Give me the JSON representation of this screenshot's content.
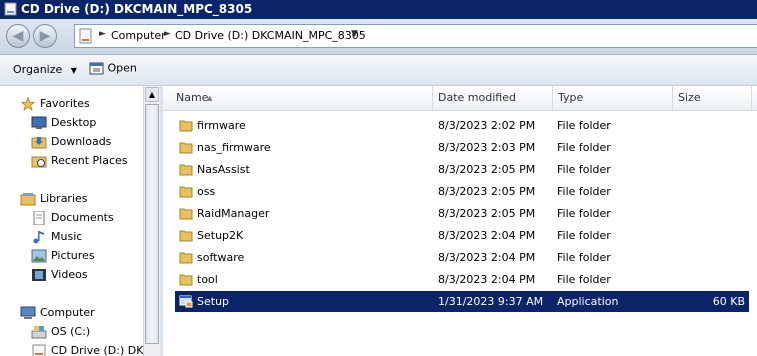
{
  "window": {
    "title": "CD Drive (D:) DKCMAIN_MPC_8305"
  },
  "address": {
    "items": [
      "Computer",
      "CD Drive (D:) DKCMAIN_MPC_8305"
    ]
  },
  "toolbar": {
    "organize_label": "Organize",
    "open_label": "Open"
  },
  "nav": {
    "favorites": {
      "label": "Favorites",
      "items": [
        "Desktop",
        "Downloads",
        "Recent Places"
      ]
    },
    "libraries": {
      "label": "Libraries",
      "items": [
        "Documents",
        "Music",
        "Pictures",
        "Videos"
      ]
    },
    "computer": {
      "label": "Computer",
      "items": [
        "OS (C:)",
        "CD Drive (D:) DKCM"
      ]
    }
  },
  "columns": {
    "name": "Name",
    "date": "Date modified",
    "type": "Type",
    "size": "Size"
  },
  "files": [
    {
      "name": "firmware",
      "date": "8/3/2023 2:02 PM",
      "type": "File folder",
      "size": ""
    },
    {
      "name": "nas_firmware",
      "date": "8/3/2023 2:03 PM",
      "type": "File folder",
      "size": ""
    },
    {
      "name": "NasAssist",
      "date": "8/3/2023 2:05 PM",
      "type": "File folder",
      "size": ""
    },
    {
      "name": "oss",
      "date": "8/3/2023 2:05 PM",
      "type": "File folder",
      "size": ""
    },
    {
      "name": "RaidManager",
      "date": "8/3/2023 2:05 PM",
      "type": "File folder",
      "size": ""
    },
    {
      "name": "Setup2K",
      "date": "8/3/2023 2:04 PM",
      "type": "File folder",
      "size": ""
    },
    {
      "name": "software",
      "date": "8/3/2023 2:04 PM",
      "type": "File folder",
      "size": ""
    },
    {
      "name": "tool",
      "date": "8/3/2023 2:04 PM",
      "type": "File folder",
      "size": ""
    },
    {
      "name": "Setup",
      "date": "1/31/2023 9:37 AM",
      "type": "Application",
      "size": "60 KB",
      "selected": true
    }
  ],
  "colors": {
    "titlebar": "#0a246a",
    "selection": "#0a246a",
    "folder": "#e8c15a"
  }
}
